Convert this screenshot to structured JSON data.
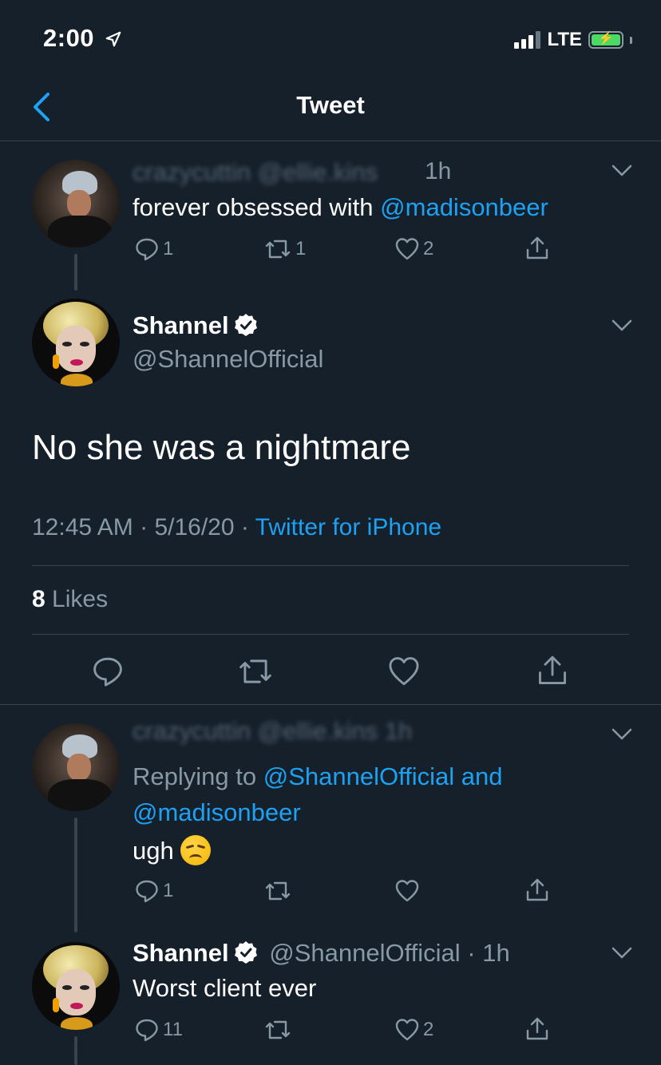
{
  "status_bar": {
    "time": "2:00",
    "network": "LTE"
  },
  "nav": {
    "title": "Tweet"
  },
  "parent_tweet": {
    "blurred_header": "crazycuttin @ellie.kins",
    "time": "1h",
    "text_prefix": "forever obsessed with ",
    "mention": "@madisonbeer",
    "replies": "1",
    "retweets": "1",
    "likes": "2"
  },
  "main_tweet": {
    "name": "Shannel",
    "handle": "@ShannelOfficial",
    "text": "No she was a nightmare",
    "time": "12:45 AM",
    "date": "5/16/20",
    "source": "Twitter for iPhone",
    "likes_count": "8",
    "likes_label": "Likes"
  },
  "reply_1": {
    "blurred_header": "crazycuttin @ellie.kins 1h",
    "replying_prefix": "Replying to ",
    "replying_to": "@ShannelOfficial",
    "replying_and": " and",
    "replying_to_2": "@madisonbeer",
    "text": "ugh",
    "emoji": "disappointed-face",
    "replies": "1"
  },
  "reply_2": {
    "name": "Shannel",
    "handle": "@ShannelOfficial",
    "sep": "·",
    "time": "1h",
    "text": "Worst client ever",
    "replies": "11",
    "likes": "2"
  },
  "colors": {
    "background": "#15202b",
    "link": "#1da1f2",
    "muted": "#8899a6",
    "divider": "#38444d"
  }
}
